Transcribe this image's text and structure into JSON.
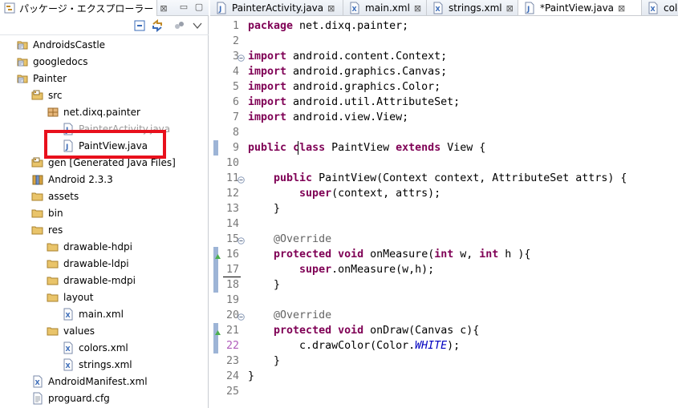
{
  "explorer": {
    "tab_label": "パッケージ・エクスプローラー",
    "tab_close": "⊠",
    "minimize": "▭",
    "maximize": "▢",
    "tree": [
      {
        "label": "AndroidsCastle",
        "icon": "android-project-icon",
        "indent": 0
      },
      {
        "label": "googledocs",
        "icon": "android-project-icon",
        "indent": 0
      },
      {
        "label": "Painter",
        "icon": "android-project-icon",
        "indent": 0
      },
      {
        "label": "src",
        "icon": "source-folder-icon",
        "indent": 1
      },
      {
        "label": "net.dixq.painter",
        "icon": "package-icon",
        "indent": 2
      },
      {
        "label": "PainterActivity.java",
        "icon": "java-file-icon",
        "indent": 3
      },
      {
        "label": "PaintView.java",
        "icon": "java-file-icon",
        "indent": 3
      },
      {
        "label": "gen [Generated Java Files]",
        "icon": "source-folder-icon",
        "indent": 1
      },
      {
        "label": "Android 2.3.3",
        "icon": "library-icon",
        "indent": 1
      },
      {
        "label": "assets",
        "icon": "folder-icon",
        "indent": 1
      },
      {
        "label": "bin",
        "icon": "folder-icon",
        "indent": 1
      },
      {
        "label": "res",
        "icon": "folder-icon",
        "indent": 1
      },
      {
        "label": "drawable-hdpi",
        "icon": "folder-icon",
        "indent": 2
      },
      {
        "label": "drawable-ldpi",
        "icon": "folder-icon",
        "indent": 2
      },
      {
        "label": "drawable-mdpi",
        "icon": "folder-icon",
        "indent": 2
      },
      {
        "label": "layout",
        "icon": "folder-icon",
        "indent": 2
      },
      {
        "label": "main.xml",
        "icon": "xml-file-icon",
        "indent": 3
      },
      {
        "label": "values",
        "icon": "folder-icon",
        "indent": 2
      },
      {
        "label": "colors.xml",
        "icon": "xml-file-icon",
        "indent": 3
      },
      {
        "label": "strings.xml",
        "icon": "xml-file-icon",
        "indent": 3
      },
      {
        "label": "AndroidManifest.xml",
        "icon": "xml-file-icon",
        "indent": 1
      },
      {
        "label": "proguard.cfg",
        "icon": "text-file-icon",
        "indent": 1
      }
    ]
  },
  "editor": {
    "tabs": [
      {
        "label": "PainterActivity.java",
        "icon": "java-file-icon",
        "close": "⊠"
      },
      {
        "label": "main.xml",
        "icon": "xml-file-icon",
        "close": "⊠"
      },
      {
        "label": "strings.xml",
        "icon": "xml-file-icon",
        "close": "⊠"
      },
      {
        "label": "*PaintView.java",
        "icon": "java-file-icon",
        "close": "⊠"
      },
      {
        "label": "colo",
        "icon": "xml-file-icon",
        "close": ""
      }
    ],
    "lines": [
      "1",
      "2",
      "3",
      "4",
      "5",
      "6",
      "7",
      "8",
      "9",
      "10",
      "11",
      "12",
      "13",
      "14",
      "15",
      "16",
      "17",
      "18",
      "19",
      "20",
      "21",
      "22",
      "23",
      "24",
      "25"
    ]
  },
  "colors": {
    "keyword": "#7f0055",
    "annotation": "#646464",
    "constant": "#0000c0",
    "highlight_box": "#e8101c"
  }
}
